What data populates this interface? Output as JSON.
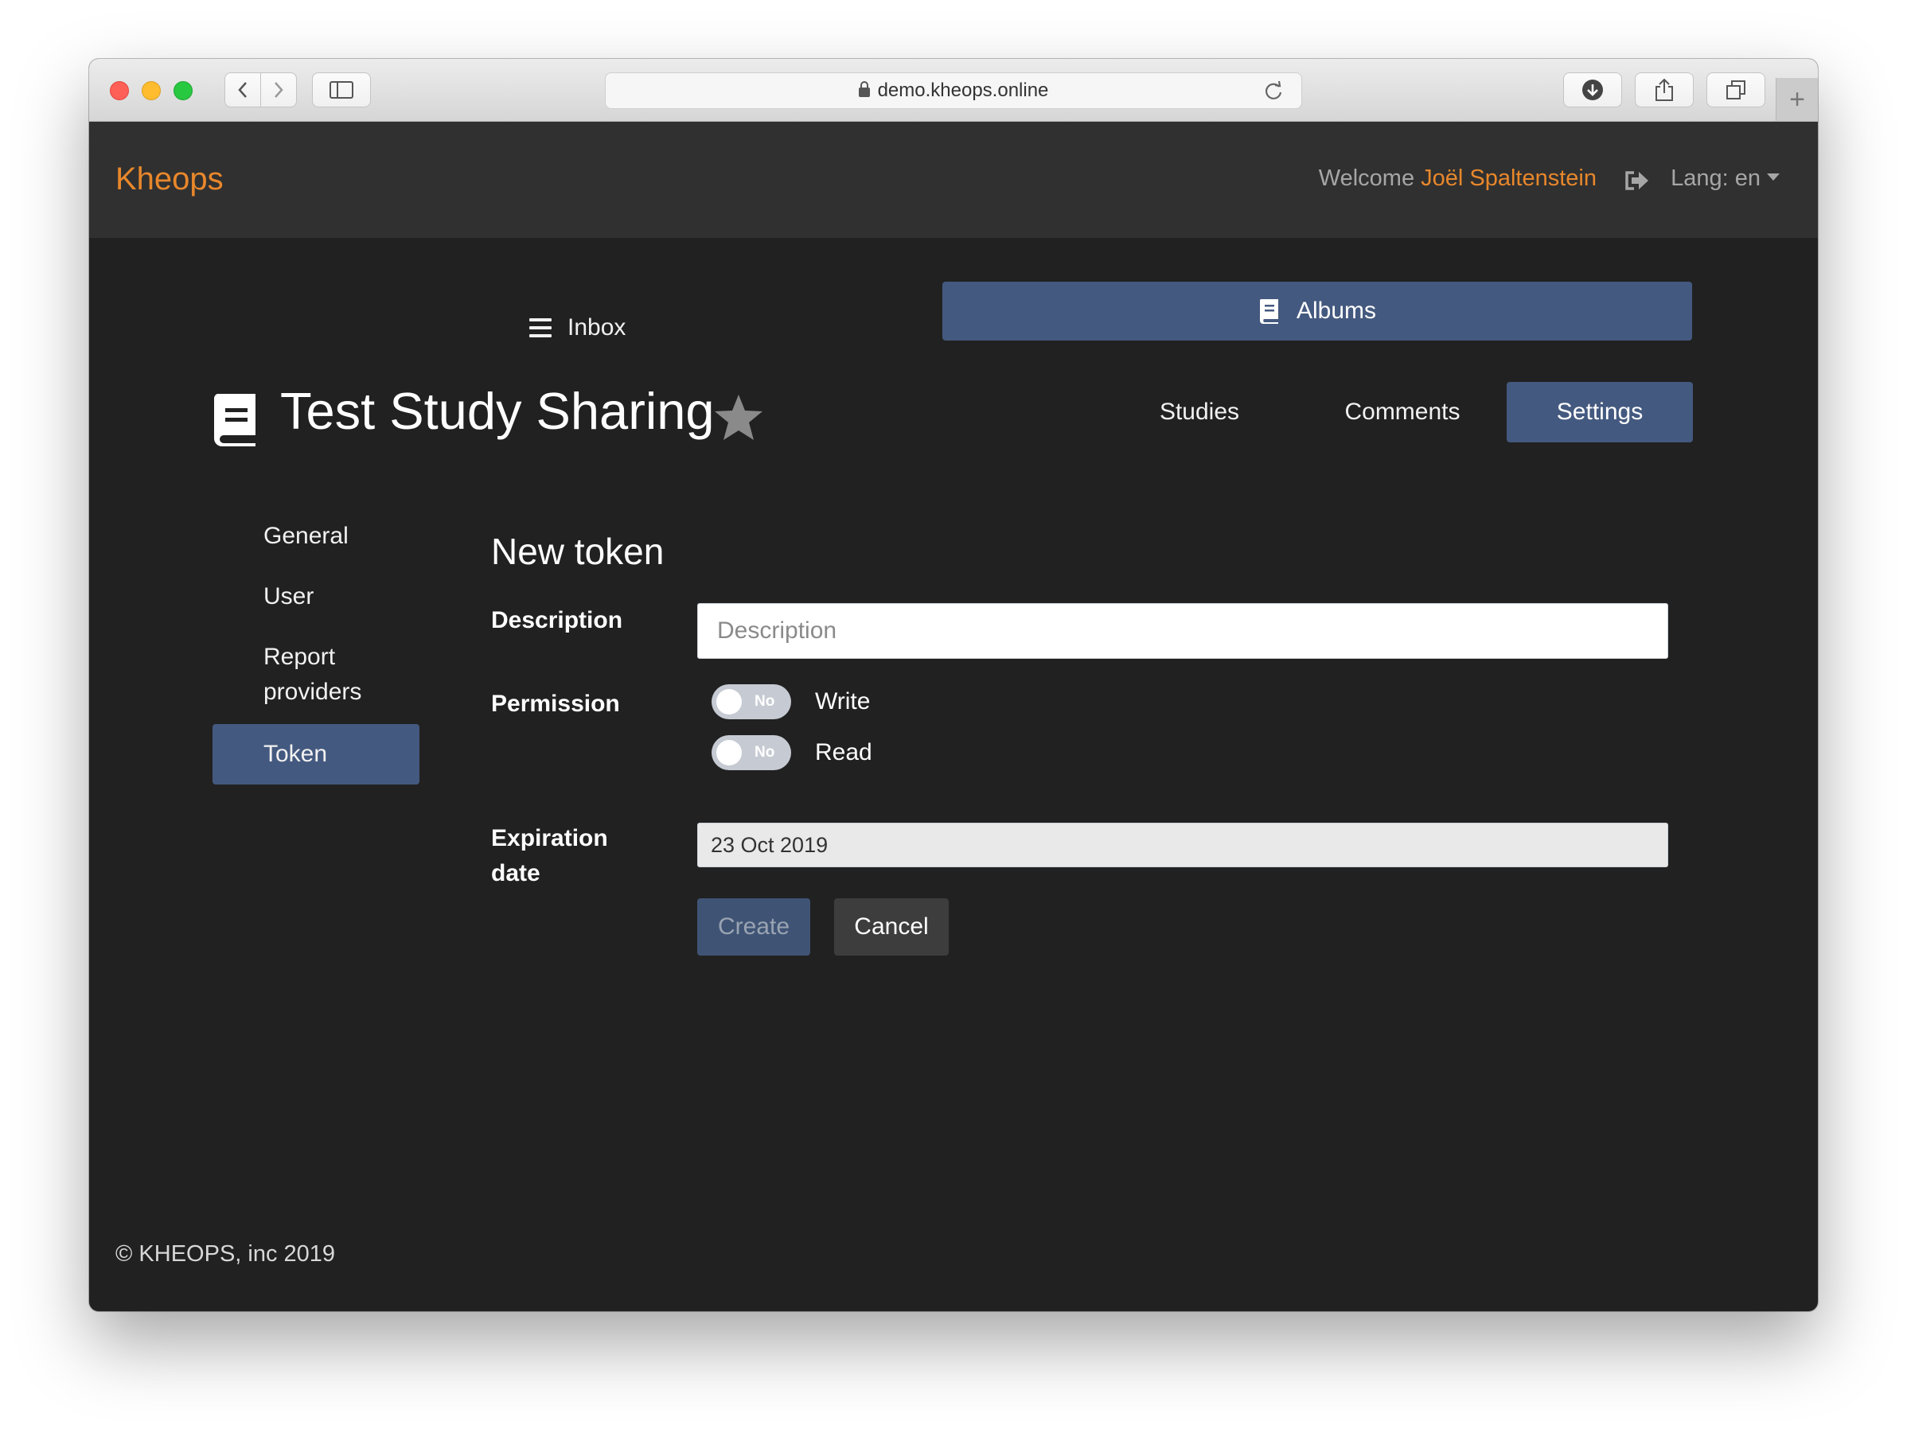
{
  "browser": {
    "url": "demo.kheops.online",
    "new_tab": "+"
  },
  "navbar": {
    "brand": "Kheops",
    "welcome_prefix": "Welcome ",
    "user_name": "Joël Spaltenstein",
    "lang_label": "Lang: en"
  },
  "main_nav": {
    "inbox": "Inbox",
    "albums": "Albums"
  },
  "album": {
    "title": "Test Study Sharing",
    "tabs": [
      "Studies",
      "Comments",
      "Settings"
    ]
  },
  "settings_menu": {
    "items": [
      "General",
      "User",
      "Report providers",
      "Token"
    ],
    "active": "Token"
  },
  "form": {
    "title": "New token",
    "description_label": "Description",
    "description_placeholder": "Description",
    "permission_label": "Permission",
    "permissions": [
      {
        "label": "Write",
        "state": "No"
      },
      {
        "label": "Read",
        "state": "No"
      }
    ],
    "expiration_label": "Expiration date",
    "expiration_value": "23 Oct 2019",
    "create_label": "Create",
    "cancel_label": "Cancel"
  },
  "footer": {
    "copyright": "© KHEOPS, inc 2019"
  },
  "colors": {
    "accent_orange": "#e8872b",
    "active_blue": "#44597f",
    "background": "#212121",
    "navbar": "#303030"
  }
}
